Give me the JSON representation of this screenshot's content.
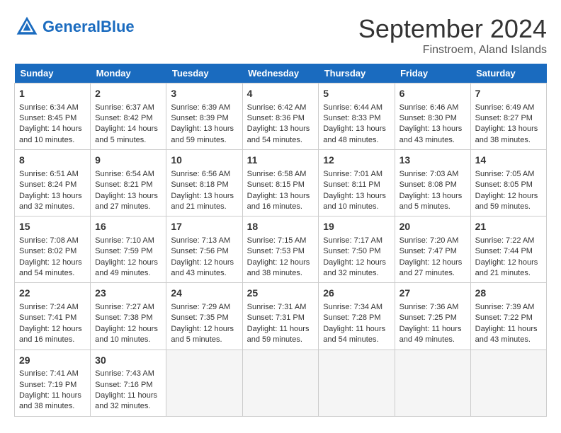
{
  "header": {
    "logo_general": "General",
    "logo_blue": "Blue",
    "month_title": "September 2024",
    "location": "Finstroem, Aland Islands"
  },
  "weekdays": [
    "Sunday",
    "Monday",
    "Tuesday",
    "Wednesday",
    "Thursday",
    "Friday",
    "Saturday"
  ],
  "weeks": [
    [
      {
        "day": "1",
        "sunrise": "6:34 AM",
        "sunset": "8:45 PM",
        "daylight": "14 hours and 10 minutes."
      },
      {
        "day": "2",
        "sunrise": "6:37 AM",
        "sunset": "8:42 PM",
        "daylight": "14 hours and 5 minutes."
      },
      {
        "day": "3",
        "sunrise": "6:39 AM",
        "sunset": "8:39 PM",
        "daylight": "13 hours and 59 minutes."
      },
      {
        "day": "4",
        "sunrise": "6:42 AM",
        "sunset": "8:36 PM",
        "daylight": "13 hours and 54 minutes."
      },
      {
        "day": "5",
        "sunrise": "6:44 AM",
        "sunset": "8:33 PM",
        "daylight": "13 hours and 48 minutes."
      },
      {
        "day": "6",
        "sunrise": "6:46 AM",
        "sunset": "8:30 PM",
        "daylight": "13 hours and 43 minutes."
      },
      {
        "day": "7",
        "sunrise": "6:49 AM",
        "sunset": "8:27 PM",
        "daylight": "13 hours and 38 minutes."
      }
    ],
    [
      {
        "day": "8",
        "sunrise": "6:51 AM",
        "sunset": "8:24 PM",
        "daylight": "13 hours and 32 minutes."
      },
      {
        "day": "9",
        "sunrise": "6:54 AM",
        "sunset": "8:21 PM",
        "daylight": "13 hours and 27 minutes."
      },
      {
        "day": "10",
        "sunrise": "6:56 AM",
        "sunset": "8:18 PM",
        "daylight": "13 hours and 21 minutes."
      },
      {
        "day": "11",
        "sunrise": "6:58 AM",
        "sunset": "8:15 PM",
        "daylight": "13 hours and 16 minutes."
      },
      {
        "day": "12",
        "sunrise": "7:01 AM",
        "sunset": "8:11 PM",
        "daylight": "13 hours and 10 minutes."
      },
      {
        "day": "13",
        "sunrise": "7:03 AM",
        "sunset": "8:08 PM",
        "daylight": "13 hours and 5 minutes."
      },
      {
        "day": "14",
        "sunrise": "7:05 AM",
        "sunset": "8:05 PM",
        "daylight": "12 hours and 59 minutes."
      }
    ],
    [
      {
        "day": "15",
        "sunrise": "7:08 AM",
        "sunset": "8:02 PM",
        "daylight": "12 hours and 54 minutes."
      },
      {
        "day": "16",
        "sunrise": "7:10 AM",
        "sunset": "7:59 PM",
        "daylight": "12 hours and 49 minutes."
      },
      {
        "day": "17",
        "sunrise": "7:13 AM",
        "sunset": "7:56 PM",
        "daylight": "12 hours and 43 minutes."
      },
      {
        "day": "18",
        "sunrise": "7:15 AM",
        "sunset": "7:53 PM",
        "daylight": "12 hours and 38 minutes."
      },
      {
        "day": "19",
        "sunrise": "7:17 AM",
        "sunset": "7:50 PM",
        "daylight": "12 hours and 32 minutes."
      },
      {
        "day": "20",
        "sunrise": "7:20 AM",
        "sunset": "7:47 PM",
        "daylight": "12 hours and 27 minutes."
      },
      {
        "day": "21",
        "sunrise": "7:22 AM",
        "sunset": "7:44 PM",
        "daylight": "12 hours and 21 minutes."
      }
    ],
    [
      {
        "day": "22",
        "sunrise": "7:24 AM",
        "sunset": "7:41 PM",
        "daylight": "12 hours and 16 minutes."
      },
      {
        "day": "23",
        "sunrise": "7:27 AM",
        "sunset": "7:38 PM",
        "daylight": "12 hours and 10 minutes."
      },
      {
        "day": "24",
        "sunrise": "7:29 AM",
        "sunset": "7:35 PM",
        "daylight": "12 hours and 5 minutes."
      },
      {
        "day": "25",
        "sunrise": "7:31 AM",
        "sunset": "7:31 PM",
        "daylight": "11 hours and 59 minutes."
      },
      {
        "day": "26",
        "sunrise": "7:34 AM",
        "sunset": "7:28 PM",
        "daylight": "11 hours and 54 minutes."
      },
      {
        "day": "27",
        "sunrise": "7:36 AM",
        "sunset": "7:25 PM",
        "daylight": "11 hours and 49 minutes."
      },
      {
        "day": "28",
        "sunrise": "7:39 AM",
        "sunset": "7:22 PM",
        "daylight": "11 hours and 43 minutes."
      }
    ],
    [
      {
        "day": "29",
        "sunrise": "7:41 AM",
        "sunset": "7:19 PM",
        "daylight": "11 hours and 38 minutes."
      },
      {
        "day": "30",
        "sunrise": "7:43 AM",
        "sunset": "7:16 PM",
        "daylight": "11 hours and 32 minutes."
      },
      null,
      null,
      null,
      null,
      null
    ]
  ]
}
